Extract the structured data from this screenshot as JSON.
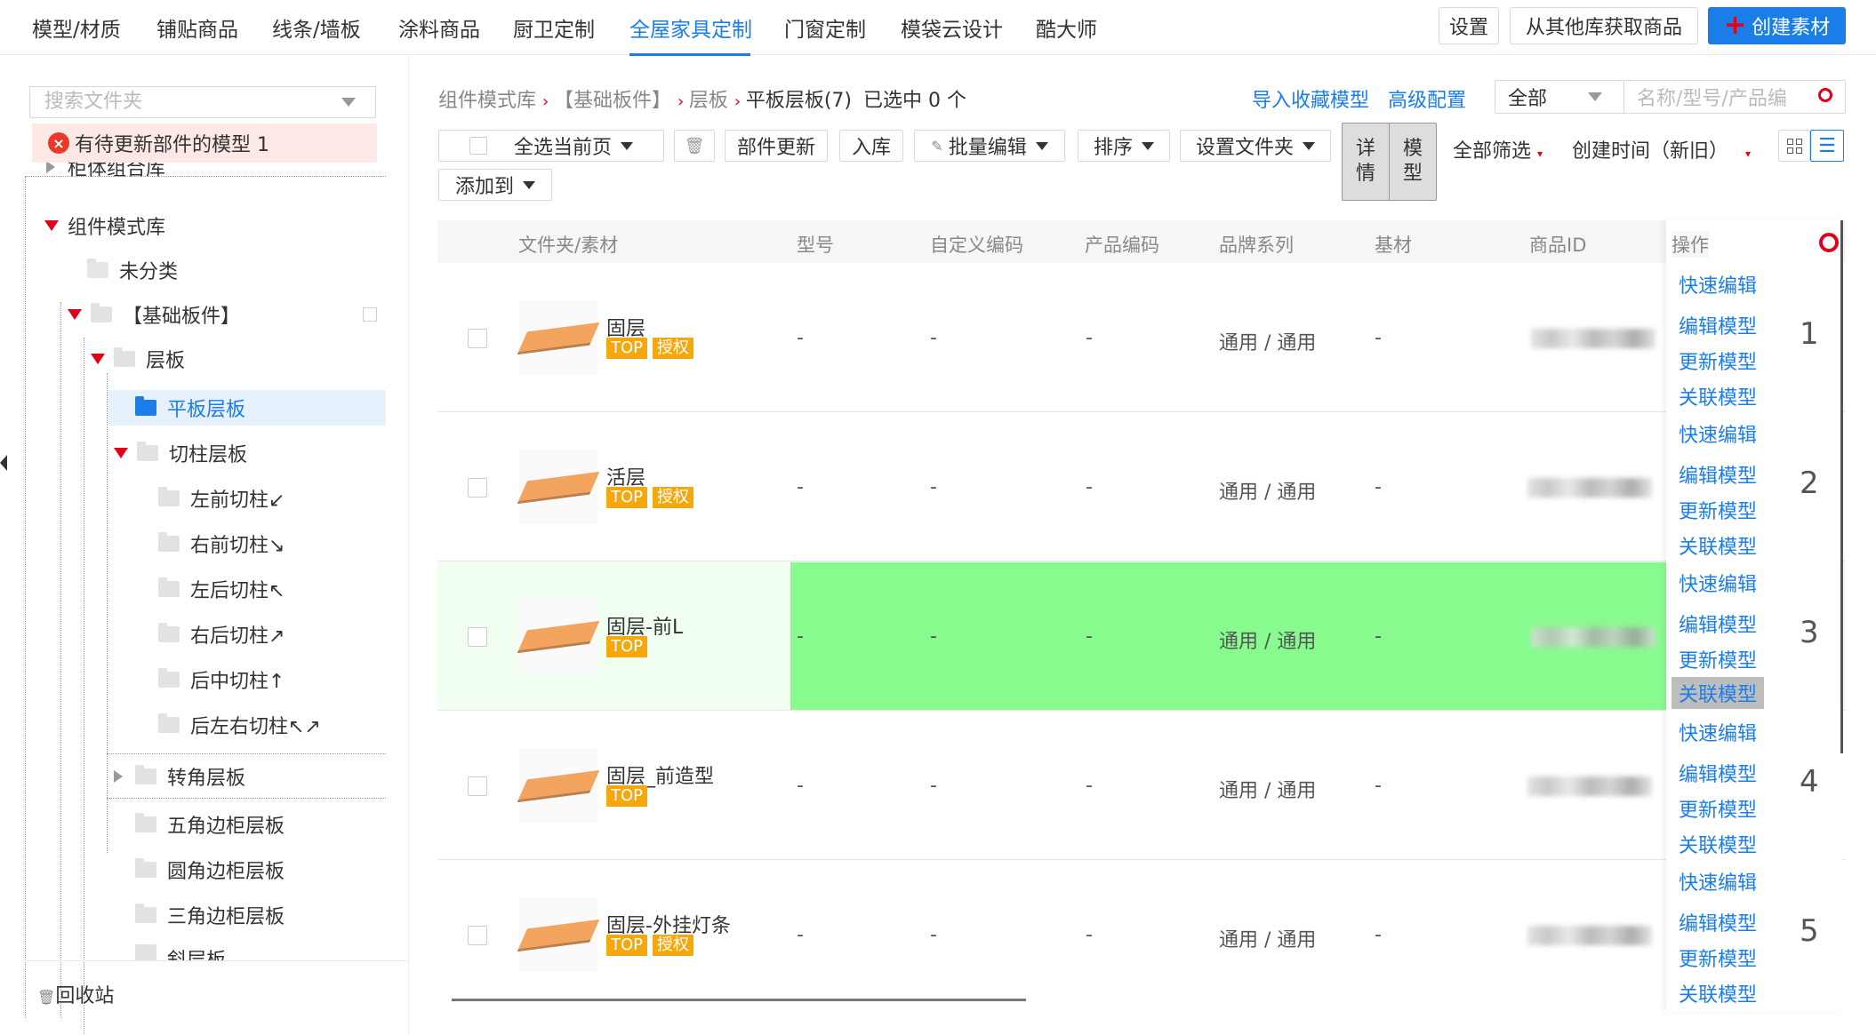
{
  "nav": {
    "items": [
      "模型/材质",
      "铺贴商品",
      "线条/墙板",
      "涂料商品",
      "厨卫定制",
      "全屋家具定制",
      "门窗定制",
      "模袋云设计",
      "酷大师"
    ],
    "active_index": 5,
    "settings_label": "设置",
    "import_label": "从其他库获取商品",
    "create_label": "创建素材",
    "accent_color": "#1b7ee8"
  },
  "sidebar": {
    "search_placeholder": "搜索文件夹",
    "alert_text": "有待更新部件的模型 1",
    "tree": {
      "cabinet_lib": "柜体组合库",
      "component_lib": "组件模式库",
      "uncategorized": "未分类",
      "basic_board": "【基础板件】",
      "shelf": "层板",
      "flat_shelf": "平板层板",
      "cut_shelf": "切柱层板",
      "cut_items": [
        "左前切柱↙",
        "右前切柱↘",
        "左后切柱↖",
        "右后切柱↗",
        "后中切柱↑",
        "后左右切柱↖↗"
      ],
      "corner_shelf": "转角层板",
      "other_items": [
        "五角边柜层板",
        "圆角边柜层板",
        "三角边柜层板",
        "斜层板"
      ]
    },
    "recycle": "回收站"
  },
  "breadcrumb": {
    "items": [
      "组件模式库",
      "【基础板件】",
      "层板"
    ],
    "current": "平板层板(7)",
    "selected_text": "已选中 0 个"
  },
  "header_actions": {
    "import_fav": "导入收藏模型",
    "advanced": "高级配置",
    "scope_select": "全部",
    "search_placeholder": "名称/型号/产品编"
  },
  "toolbar": {
    "select_page": "全选当前页",
    "part_update": "部件更新",
    "stock_in": "入库",
    "batch_edit": "批量编辑",
    "sort": "排序",
    "set_folder": "设置文件夹",
    "add_to": "添加到",
    "detail": "详情",
    "model": "模型",
    "filter_all": "全部筛选",
    "sort_time": "创建时间（新旧）"
  },
  "table": {
    "columns": [
      "文件夹/素材",
      "型号",
      "自定义编码",
      "产品编码",
      "品牌系列",
      "基材",
      "商品ID",
      "操作"
    ],
    "rows": [
      {
        "name": "固层",
        "tags": [
          "TOP",
          "授权"
        ],
        "model": "-",
        "custom_code": "-",
        "product_code": "-",
        "brand": "通用 / 通用",
        "base": "-",
        "index": "1"
      },
      {
        "name": "活层",
        "tags": [
          "TOP",
          "授权"
        ],
        "model": "-",
        "custom_code": "-",
        "product_code": "-",
        "brand": "通用 / 通用",
        "base": "-",
        "index": "2"
      },
      {
        "name": "固层-前L",
        "tags": [
          "TOP"
        ],
        "model": "-",
        "custom_code": "-",
        "product_code": "-",
        "brand": "通用 / 通用",
        "base": "-",
        "index": "3"
      },
      {
        "name": "固层_前造型",
        "tags": [
          "TOP"
        ],
        "model": "-",
        "custom_code": "-",
        "product_code": "-",
        "brand": "通用 / 通用",
        "base": "-",
        "index": "4"
      },
      {
        "name": "固层-外挂灯条",
        "tags": [
          "TOP",
          "授权"
        ],
        "model": "-",
        "custom_code": "-",
        "product_code": "-",
        "brand": "通用 / 通用",
        "base": "-",
        "index": "5"
      }
    ],
    "ops": [
      "快速编辑",
      "编辑模型",
      "更新模型",
      "关联模型"
    ]
  }
}
